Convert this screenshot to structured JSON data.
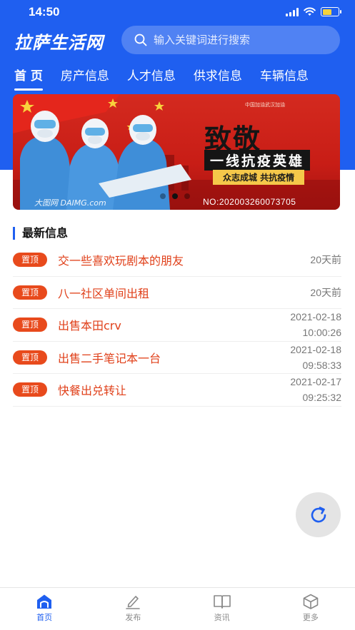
{
  "status_bar": {
    "time": "14:50"
  },
  "header": {
    "app_title": "拉萨生活网",
    "search_placeholder": "输入关键词进行搜索"
  },
  "tabs": [
    {
      "label": "首 页",
      "active": true
    },
    {
      "label": "房产信息",
      "active": false
    },
    {
      "label": "人才信息",
      "active": false
    },
    {
      "label": "供求信息",
      "active": false
    },
    {
      "label": "车辆信息",
      "active": false
    }
  ],
  "banner": {
    "top_text": "中国加油武汉加油",
    "title": "致敬",
    "subtitle": "一线抗疫英雄",
    "slogan": "众志成城 共抗疫情",
    "watermark_left": "大图网 DAIMG.com",
    "watermark_right": "NO:20200326007370​5",
    "slide_count": 3,
    "active_slide": 2
  },
  "section": {
    "title": "最新信息"
  },
  "list_items": [
    {
      "badge": "置顶",
      "title": "交一些喜欢玩剧本的朋友",
      "date": "",
      "time": "20天前"
    },
    {
      "badge": "置顶",
      "title": "八一社区单间出租",
      "date": "",
      "time": "20天前"
    },
    {
      "badge": "置顶",
      "title": "出售本田crv",
      "date": "2021-02-18",
      "time": "10:00:26"
    },
    {
      "badge": "置顶",
      "title": "出售二手笔记本一台",
      "date": "2021-02-18",
      "time": "09:58:33"
    },
    {
      "badge": "置顶",
      "title": "快餐出兑转让",
      "date": "2021-02-17",
      "time": "09:25:32"
    }
  ],
  "bottom_nav": [
    {
      "label": "首页",
      "icon": "home-icon",
      "active": true
    },
    {
      "label": "发布",
      "icon": "edit-icon",
      "active": false
    },
    {
      "label": "资讯",
      "icon": "book-icon",
      "active": false
    },
    {
      "label": "更多",
      "icon": "cube-icon",
      "active": false
    }
  ],
  "colors": {
    "brand_blue": "#1f5ff0",
    "badge_red": "#e84a1c",
    "title_red": "#e0401a"
  }
}
